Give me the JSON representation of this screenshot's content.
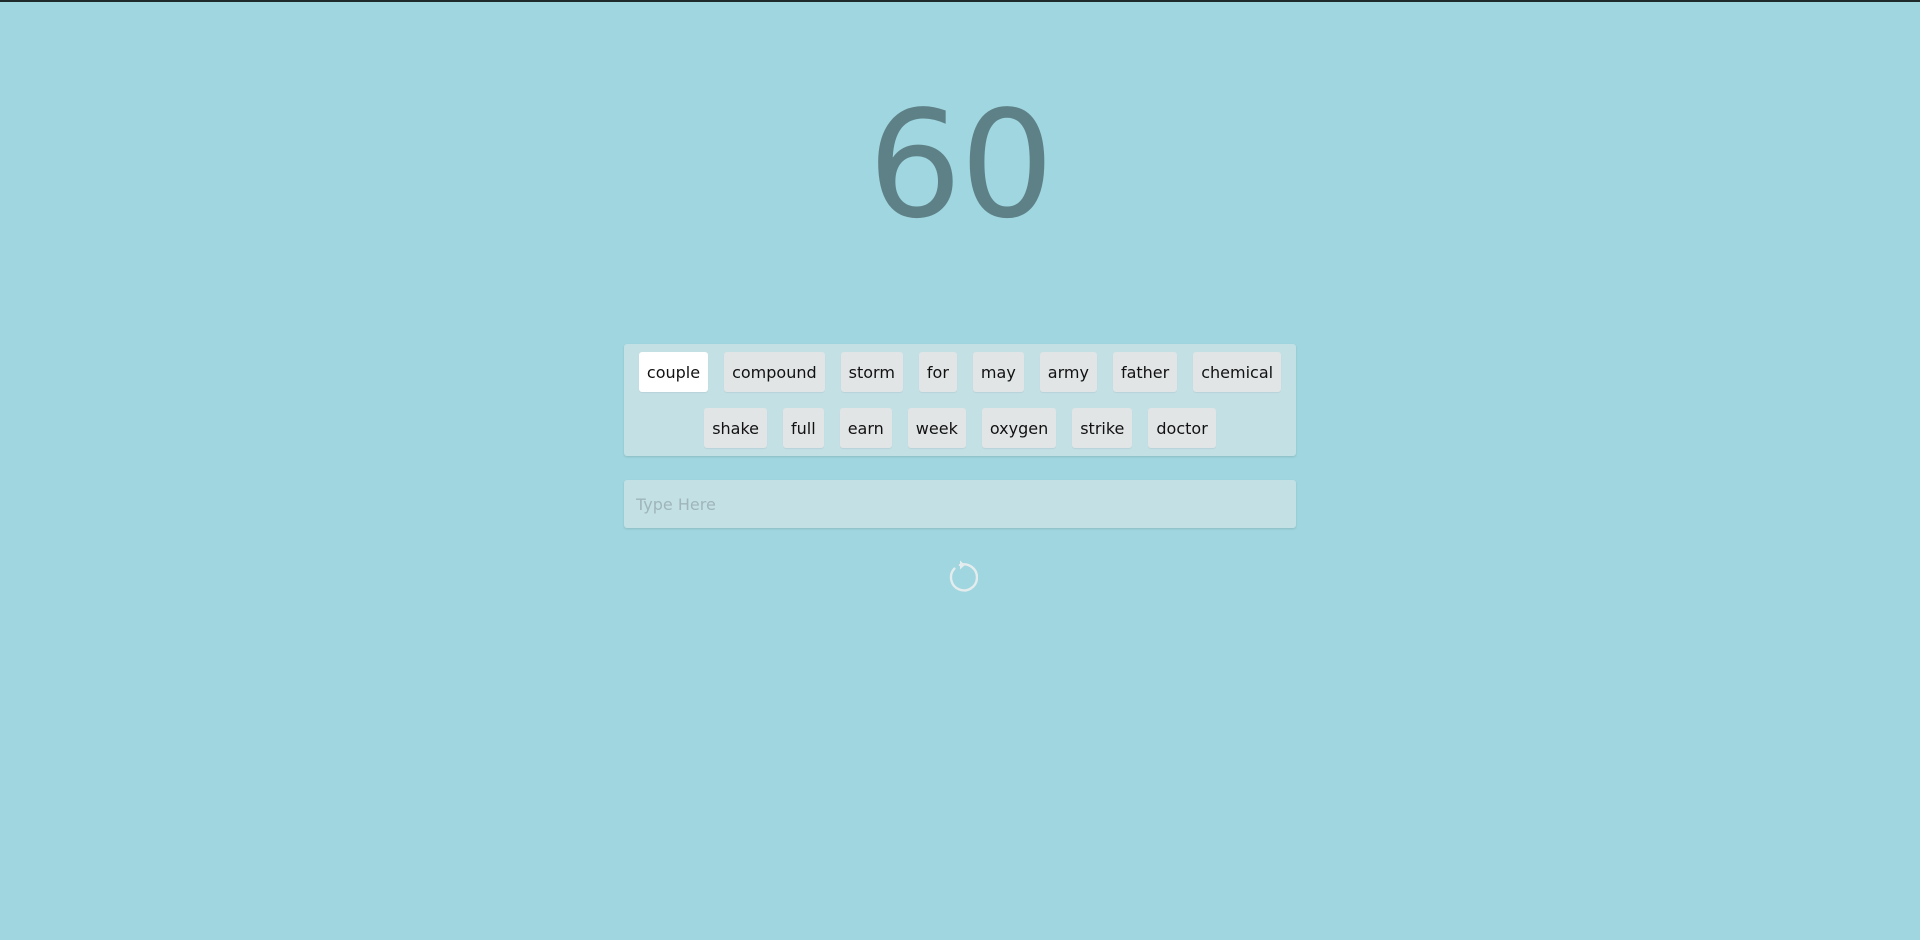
{
  "timer": {
    "value": "60"
  },
  "words": {
    "row1": [
      "couple",
      "compound",
      "storm",
      "for",
      "may",
      "army",
      "father",
      "chemical"
    ],
    "row2": [
      "shake",
      "full",
      "earn",
      "week",
      "oxygen",
      "strike",
      "doctor"
    ],
    "current_word": "couple"
  },
  "input": {
    "placeholder": "Type Here",
    "value": ""
  },
  "reset": {
    "icon": "refresh-icon"
  },
  "colors": {
    "background": "#9fd6df",
    "panel": "#c3e0e5",
    "word_chip": "#e1e5e6",
    "current_word_chip": "#ffffff",
    "timer_text": "#5e8187"
  }
}
